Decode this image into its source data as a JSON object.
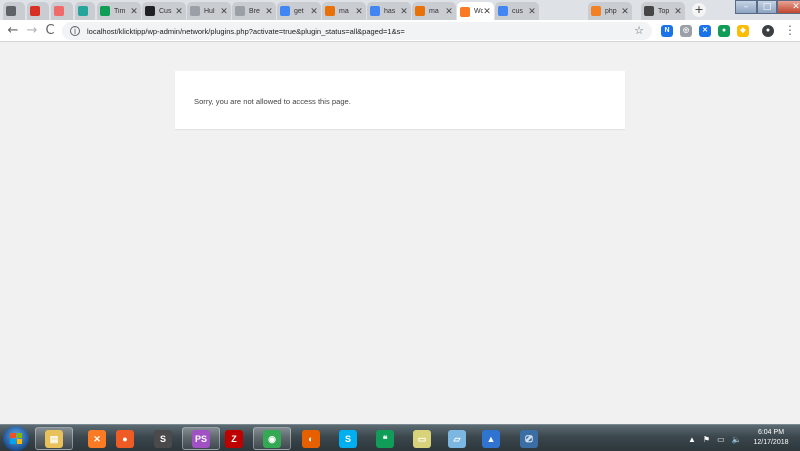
{
  "browser": {
    "tabs": [
      {
        "title": "",
        "favicon_icon": "document-icon",
        "favicon_color": "#5f6368",
        "active": false
      },
      {
        "title": "",
        "favicon_icon": "gmail-icon",
        "favicon_color": "#d93025",
        "active": false
      },
      {
        "title": "",
        "favicon_icon": "asana-icon",
        "favicon_color": "#f06a6a",
        "active": false
      },
      {
        "title": "",
        "favicon_icon": "pin-icon",
        "favicon_color": "#26a69a",
        "active": false
      },
      {
        "title": "Tim",
        "favicon_icon": "sheets-icon",
        "favicon_color": "#0f9d58",
        "active": false
      },
      {
        "title": "Cus",
        "favicon_icon": "wordpress-w-icon",
        "favicon_color": "#202124",
        "active": false
      },
      {
        "title": "Hul",
        "favicon_icon": "shield-icon",
        "favicon_color": "#9aa0a6",
        "active": false
      },
      {
        "title": "Bre",
        "favicon_icon": "shield-icon",
        "favicon_color": "#9aa0a6",
        "active": false
      },
      {
        "title": "get",
        "favicon_icon": "google-icon",
        "favicon_color": "#4285f4",
        "active": false
      },
      {
        "title": "ma",
        "favicon_icon": "smile-icon",
        "favicon_color": "#e8710a",
        "active": false
      },
      {
        "title": "has",
        "favicon_icon": "google-icon",
        "favicon_color": "#4285f4",
        "active": false
      },
      {
        "title": "ma",
        "favicon_icon": "smile-icon",
        "favicon_color": "#e8710a",
        "active": false
      },
      {
        "title": "Wo",
        "favicon_icon": "xampp-icon",
        "favicon_color": "#fb7a24",
        "active": true
      },
      {
        "title": "cus",
        "favicon_icon": "google-icon",
        "favicon_color": "#4285f4",
        "active": false
      },
      {
        "title": "php",
        "favicon_icon": "stackoverflow-icon",
        "favicon_color": "#f48024",
        "active": false
      },
      {
        "title": "Top",
        "favicon_icon": "wordpress-icon",
        "favicon_color": "#464646",
        "active": false
      }
    ],
    "close_glyph": "✕",
    "new_tab_glyph": "+",
    "address": {
      "info_glyph": "i",
      "url": "localhost/klicktipp/wp-admin/network/plugins.php?activate=true&plugin_status=all&paged=1&s=",
      "star_glyph": "☆"
    },
    "nav": {
      "back": "←",
      "forward": "→",
      "reload": "C"
    },
    "extensions": [
      {
        "icon": "n-extension-icon",
        "glyph": "N",
        "color": "#1a73e8"
      },
      {
        "icon": "grid-extension-icon",
        "glyph": "◎",
        "color": "#9aa0a6"
      },
      {
        "icon": "x-extension-icon",
        "glyph": "✕",
        "color": "#1a73e8"
      },
      {
        "icon": "green-dot-extension-icon",
        "glyph": "●",
        "color": "#0f9d58"
      },
      {
        "icon": "color-extension-icon",
        "glyph": "◆",
        "color": "#fbbc04"
      },
      {
        "icon": "profile-avatar-icon",
        "glyph": "●",
        "color": "#3c4043"
      }
    ],
    "menu_glyph": "⋮",
    "window_controls": {
      "minimize": "–",
      "maximize": "□",
      "close": "✕"
    }
  },
  "page": {
    "message": "Sorry, you are not allowed to access this page."
  },
  "taskbar": {
    "apps": [
      {
        "icon": "file-explorer-icon",
        "glyph": "▤",
        "color": "#e8c15a",
        "open": true
      },
      {
        "icon": "xampp-icon",
        "glyph": "✕",
        "color": "#fb7a24",
        "open": false
      },
      {
        "icon": "postman-icon",
        "glyph": "●",
        "color": "#ef5b25",
        "open": false
      },
      {
        "icon": "sublime-icon",
        "glyph": "S",
        "color": "#4a4a4a",
        "open": false
      },
      {
        "icon": "phpstorm-icon",
        "glyph": "PS",
        "color": "#a052c4",
        "open": true
      },
      {
        "icon": "filezilla-icon",
        "glyph": "Z",
        "color": "#bf0000",
        "open": false
      },
      {
        "icon": "chrome-icon",
        "glyph": "◉",
        "color": "#34a853",
        "open": true
      },
      {
        "icon": "firefox-icon",
        "glyph": "◐",
        "color": "#e66000",
        "open": false
      },
      {
        "icon": "skype-icon",
        "glyph": "S",
        "color": "#00aff0",
        "open": false
      },
      {
        "icon": "hangouts-icon",
        "glyph": "❝",
        "color": "#0f9d58",
        "open": false
      },
      {
        "icon": "notes-icon",
        "glyph": "▭",
        "color": "#d8d27a",
        "open": false
      },
      {
        "icon": "paint-icon",
        "glyph": "▱",
        "color": "#7bb7e0",
        "open": false
      },
      {
        "icon": "network-icon",
        "glyph": "▲",
        "color": "#2f74d0",
        "open": false
      },
      {
        "icon": "remote-desktop-icon",
        "glyph": "⎚",
        "color": "#3a6ea5",
        "open": false
      }
    ],
    "tray": {
      "arrow": "▲",
      "flag": "⚑",
      "monitor": "▭",
      "volume": "🔈"
    },
    "time": "6:04 PM",
    "date": "12/17/2018"
  }
}
